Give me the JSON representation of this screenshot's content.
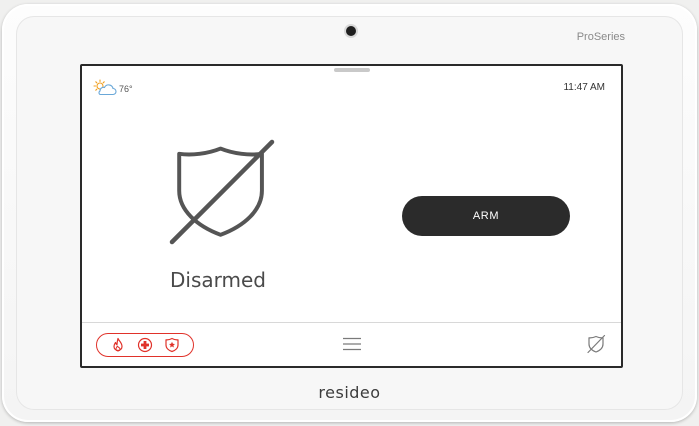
{
  "device": {
    "brand_top": "ProSeries",
    "brand_bottom": "resideo"
  },
  "status_bar": {
    "weather_icon": "partly-cloudy-icon",
    "temperature": "76°",
    "time": "11:47 AM"
  },
  "main": {
    "status_icon": "shield-slash-icon",
    "status_label": "Disarmed",
    "arm_button_label": "ARM"
  },
  "bottom_bar": {
    "emergency_icons": [
      "fire-icon",
      "medical-icon",
      "police-icon"
    ],
    "menu_icon": "hamburger-menu-icon",
    "right_icon": "disarmed-status-icon"
  },
  "colors": {
    "emergency_red": "#e0322a",
    "arm_button_bg": "#2b2b2b",
    "screen_bg": "#ffffff"
  }
}
